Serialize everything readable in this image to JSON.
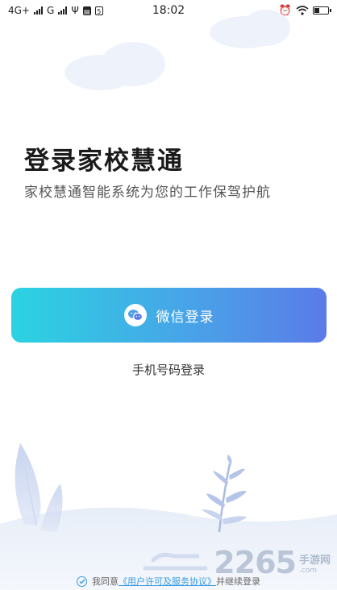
{
  "status_bar": {
    "network_1": "4G+",
    "network_2": "G",
    "time": "18:02",
    "box_icon_label": "5"
  },
  "headline": "登录家校慧通",
  "subline": "家校慧通智能系统为您的工作保驾护航",
  "wechat_button": {
    "label": "微信登录",
    "icon": "wechat-icon"
  },
  "phone_login": "手机号码登录",
  "agreement": {
    "prefix": "我同意",
    "link": "《用户许可及服务协议》",
    "suffix": "并继续登录"
  },
  "watermark": {
    "number": "2265",
    "cn": "手游网",
    "url": ".com"
  },
  "colors": {
    "button_gradient_start": "#2bd3e2",
    "button_gradient_end": "#5b7be8",
    "link": "#3b9be0"
  }
}
